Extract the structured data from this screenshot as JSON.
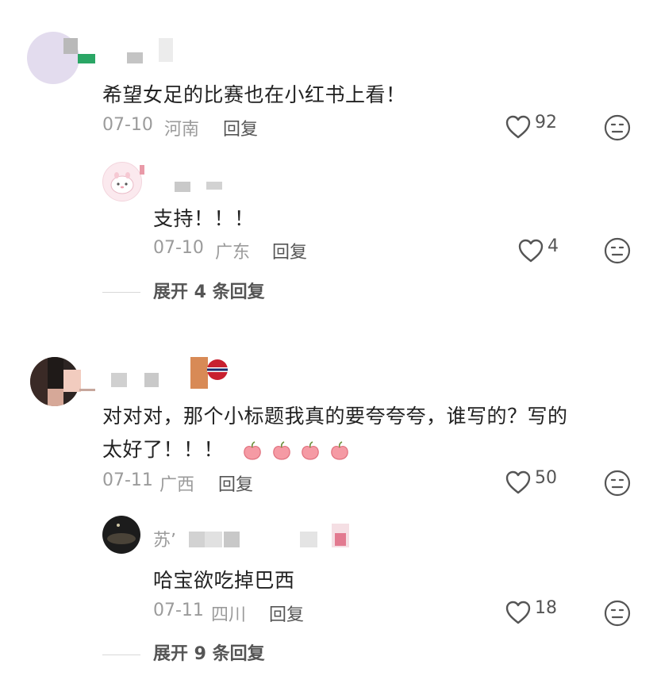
{
  "comments": [
    {
      "text": "希望女足的比赛也在小红书上看！",
      "date": "07-10",
      "location": "河南",
      "reply_label": "回复",
      "likes": "92",
      "reply": {
        "text": "支持！！！",
        "date": "07-10",
        "location": "广东",
        "reply_label": "回复",
        "likes": "4"
      },
      "expand_label": "展开 4 条回复"
    },
    {
      "text_line1": "对对对，那个小标题我真的要夸夸夸，谁写的？写的",
      "text_line2": "太好了！！！",
      "date": "07-11",
      "location": "广西",
      "reply_label": "回复",
      "likes": "50",
      "reply": {
        "name_partial": "苏ʼ",
        "text": "哈宝欲吃掉巴西",
        "date": "07-11",
        "location": "四川",
        "reply_label": "回复",
        "likes": "18"
      },
      "expand_label": "展开 9 条回复"
    }
  ],
  "icons": {
    "heart": "heart-outline-icon",
    "emoji": "emoji-face-icon",
    "peach": "peach-emoji-icon"
  },
  "colors": {
    "text": "#222222",
    "meta": "#9b9b9b",
    "icon": "#555555"
  }
}
